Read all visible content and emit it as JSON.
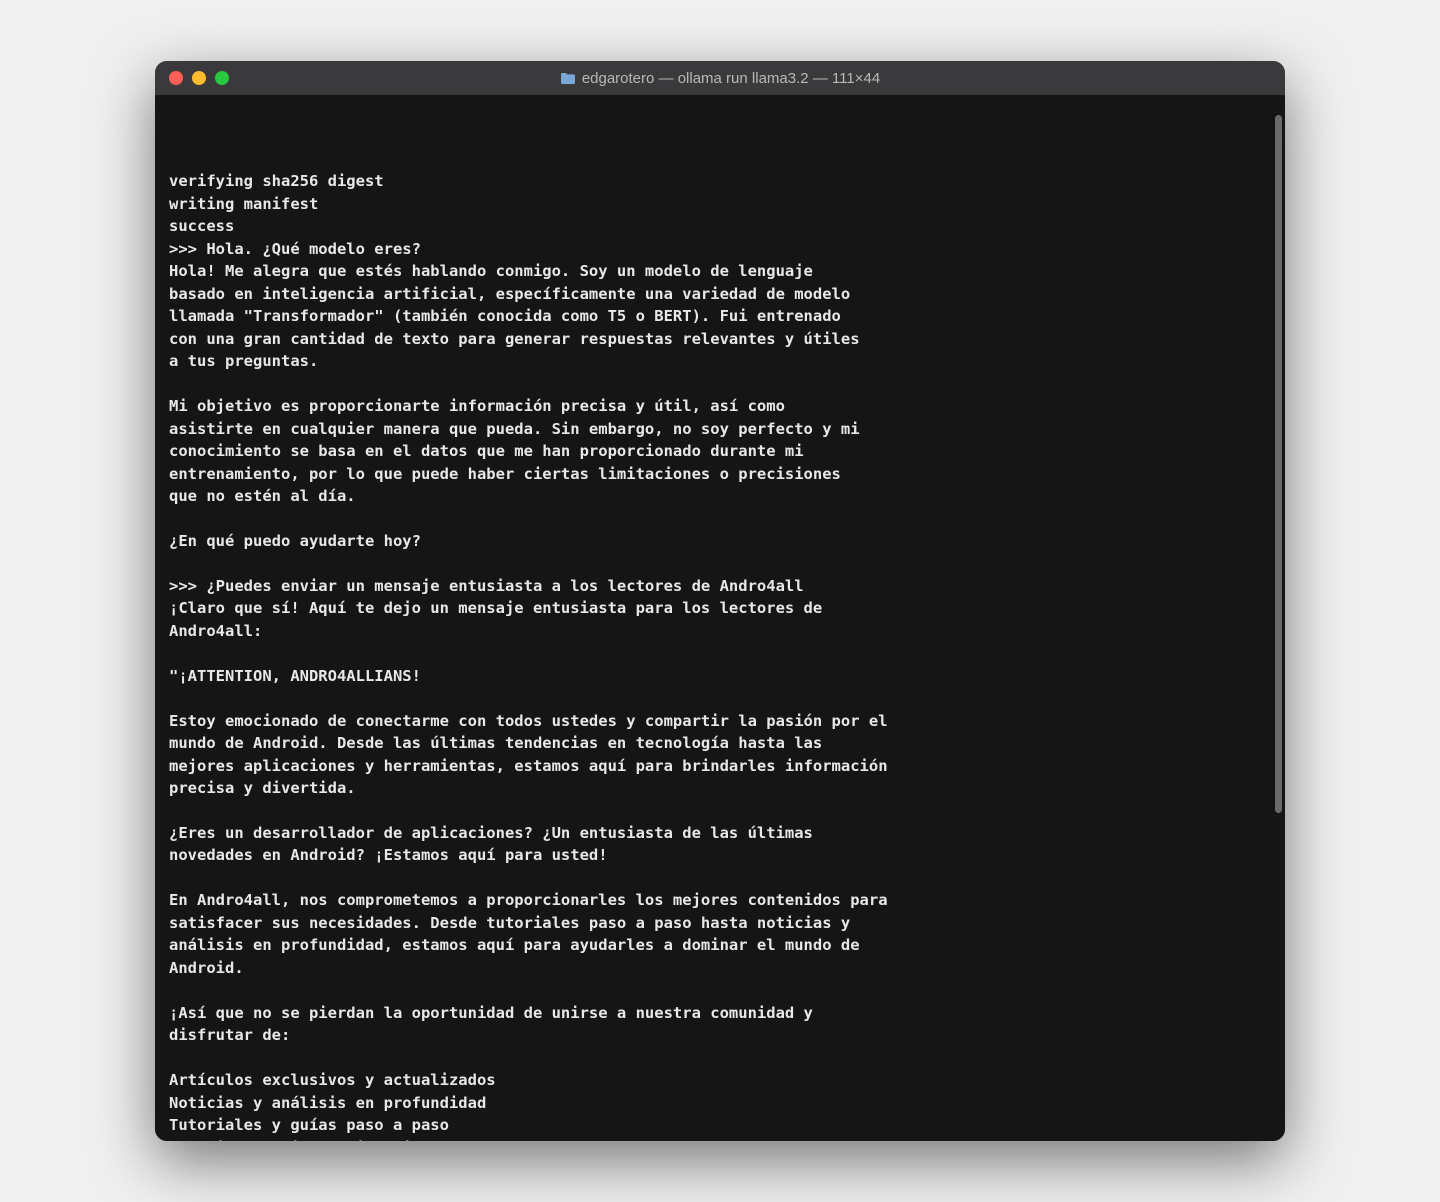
{
  "window": {
    "title": "edgarotero — ollama run llama3.2 — 111×44",
    "traffic_lights": {
      "close": "close",
      "minimize": "minimize",
      "maximize": "maximize"
    }
  },
  "terminal": {
    "lines": [
      "verifying sha256 digest",
      "writing manifest",
      "success",
      ">>> Hola. ¿Qué modelo eres?",
      "Hola! Me alegra que estés hablando conmigo. Soy un modelo de lenguaje",
      "basado en inteligencia artificial, específicamente una variedad de modelo",
      "llamada \"Transformador\" (también conocida como T5 o BERT). Fui entrenado",
      "con una gran cantidad de texto para generar respuestas relevantes y útiles",
      "a tus preguntas.",
      "",
      "Mi objetivo es proporcionarte información precisa y útil, así como",
      "asistirte en cualquier manera que pueda. Sin embargo, no soy perfecto y mi",
      "conocimiento se basa en el datos que me han proporcionado durante mi",
      "entrenamiento, por lo que puede haber ciertas limitaciones o precisiones",
      "que no estén al día.",
      "",
      "¿En qué puedo ayudarte hoy?",
      "",
      ">>> ¿Puedes enviar un mensaje entusiasta a los lectores de Andro4all",
      "¡Claro que sí! Aquí te dejo un mensaje entusiasta para los lectores de",
      "Andro4all:",
      "",
      "\"¡ATTENTION, ANDRO4ALLIANS!",
      "",
      "Estoy emocionado de conectarme con todos ustedes y compartir la pasión por el",
      "mundo de Android. Desde las últimas tendencias en tecnología hasta las",
      "mejores aplicaciones y herramientas, estamos aquí para brindarles información",
      "precisa y divertida.",
      "",
      "¿Eres un desarrollador de aplicaciones? ¿Un entusiasta de las últimas",
      "novedades en Android? ¡Estamos aquí para usted!",
      "",
      "En Andro4all, nos comprometemos a proporcionarles los mejores contenidos para",
      "satisfacer sus necesidades. Desde tutoriales paso a paso hasta noticias y",
      "análisis en profundidad, estamos aquí para ayudarles a dominar el mundo de",
      "Android.",
      "",
      "¡Así que no se pierdan la oportunidad de unirse a nuestra comunidad y",
      "disfrutar de:",
      "",
      "Artículos exclusivos y actualizados",
      "Noticias y análisis en profundidad",
      "Tutoriales y guías paso a paso",
      "Comunidad activa y divertida"
    ],
    "scrollbar": {
      "top_pct": 1,
      "height_pct": 68
    }
  }
}
